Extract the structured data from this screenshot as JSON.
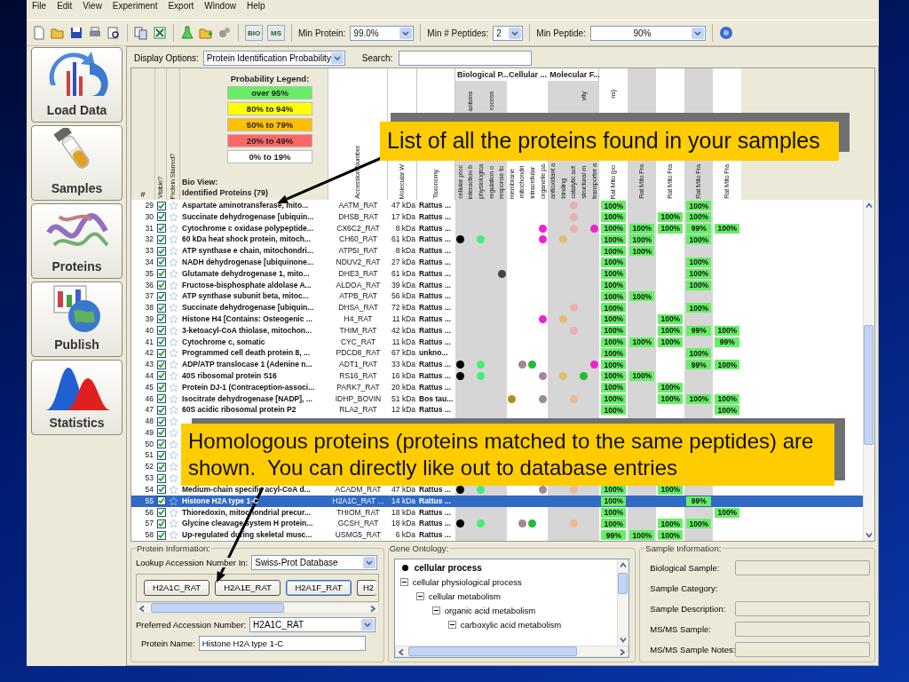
{
  "menu": [
    "File",
    "Edit",
    "View",
    "Experiment",
    "Export",
    "Window",
    "Help"
  ],
  "toolbar": {
    "badges": [
      "BIO",
      "MS"
    ],
    "filters": [
      {
        "label": "Min Protein:",
        "value": "99.0%",
        "kind": "short"
      },
      {
        "label": "Min # Peptides:",
        "value": "2",
        "kind": "tiny"
      },
      {
        "label": "Min Peptide:",
        "value": "90%",
        "kind": "wide"
      }
    ]
  },
  "sidebar": [
    {
      "label": "Load Data",
      "kind": "load"
    },
    {
      "label": "Samples",
      "kind": "samples"
    },
    {
      "label": "Proteins",
      "kind": "proteins"
    },
    {
      "label": "Publish",
      "kind": "publish"
    },
    {
      "label": "Statistics",
      "kind": "statistics"
    }
  ],
  "options": {
    "display_label": "Display Options:",
    "display_value": "Protein Identification Probability",
    "search_label": "Search:"
  },
  "legend": {
    "title": "Probability Legend:",
    "items": [
      {
        "label": "over 95%",
        "color": "#66ee66"
      },
      {
        "label": "80% to 94%",
        "color": "#ffff00"
      },
      {
        "label": "50% to 79%",
        "color": "#ffc000"
      },
      {
        "label": "20% to  49%",
        "color": "#ff6666"
      },
      {
        "label": "0% to 19%",
        "color": "#ffffff"
      }
    ]
  },
  "table": {
    "columns": {
      "number": "#",
      "visible": "Visible?",
      "starred": "Protein Starred?",
      "view": "Bio View:",
      "name": "Identified Proteins (79)",
      "accession": "Accession Number",
      "weight": "Molecular W",
      "taxonomy": "Taxonomy"
    },
    "go_groups": [
      {
        "label": "Biological P...",
        "columns": [
          {
            "label": "cellular proc"
          },
          {
            "label": "interaction b",
            "tail": "anisms"
          },
          {
            "label": "physiologica"
          },
          {
            "label": "regulation o",
            "tail": "rocess"
          },
          {
            "label": "response to"
          }
        ]
      },
      {
        "label": "Cellular ...",
        "columns": [
          {
            "label": "membrane"
          },
          {
            "label": "mitochondri"
          },
          {
            "label": "intracellular"
          },
          {
            "label": "organelle pa"
          }
        ]
      },
      {
        "label": "Molecular F...",
        "columns": [
          {
            "label": "antioxidant a"
          },
          {
            "label": "binding"
          },
          {
            "label": "catalytic act"
          },
          {
            "label": "structural m",
            "tail": "vity"
          },
          {
            "label": "transporter a"
          }
        ]
      }
    ],
    "sample_columns": [
      {
        "label": "Rat Mito (po",
        "tail": "ns)"
      },
      {
        "label": "Rat Mito Fra"
      },
      {
        "label": "Rat Mito Fra"
      },
      {
        "label": "Rat Mito Fra"
      },
      {
        "label": "Rat Mito Fra"
      }
    ],
    "rows": [
      {
        "num": "29",
        "visible": true,
        "starred": false,
        "selected": false,
        "name": "Aspartate aminotransferase, mito...",
        "accession": "AATM_RAT",
        "weight": "47 kDa",
        "taxonomy": "Rattus ...",
        "go": {
          "go_12": {
            "color": "#e8b0b0"
          }
        },
        "samples": {
          "sample_1": "100%",
          "sample_4": "100%"
        }
      },
      {
        "num": "30",
        "visible": true,
        "starred": false,
        "selected": false,
        "name": "Succinate dehydrogenase [ubiquin...",
        "accession": "DHSB_RAT",
        "weight": "17 kDa",
        "taxonomy": "Rattus ...",
        "go": {
          "go_12": {
            "color": "#e8b0b0"
          }
        },
        "samples": {
          "sample_1": "100%",
          "sample_3": "100%",
          "sample_4": "100%"
        }
      },
      {
        "num": "31",
        "visible": true,
        "starred": false,
        "selected": false,
        "name": "Cytochrome c oxidase polypeptide...",
        "accession": "CX6C2_RAT",
        "weight": "8 kDa",
        "taxonomy": "Rattus ...",
        "go": {
          "go_9": {
            "color": "#ee22cc"
          },
          "go_12": {
            "color": "#e8b0b0"
          },
          "go_14": {
            "color": "#ee22cc"
          }
        },
        "samples": {
          "sample_1": "100%",
          "sample_2": "100%",
          "sample_3": "100%",
          "sample_4": "99%",
          "sample_5": "100%"
        }
      },
      {
        "num": "32",
        "visible": true,
        "starred": false,
        "selected": false,
        "name": "60 kDa heat shock protein, mitoch...",
        "accession": "CH60_RAT",
        "weight": "61 kDa",
        "taxonomy": "Rattus ...",
        "go": {
          "go_1": {
            "color": "#000000"
          },
          "go_3": {
            "color": "#44ee77"
          },
          "go_9": {
            "color": "#ee22cc"
          },
          "go_11": {
            "color": "#e0c070"
          }
        },
        "samples": {
          "sample_1": "100%",
          "sample_2": "100%",
          "sample_4": "100%"
        }
      },
      {
        "num": "33",
        "visible": true,
        "starred": false,
        "selected": false,
        "name": "ATP synthase e chain, mitochondri...",
        "accession": "ATP5I_RAT",
        "weight": "8 kDa",
        "taxonomy": "Rattus ...",
        "samples": {
          "sample_1": "100%",
          "sample_2": "100%"
        }
      },
      {
        "num": "34",
        "visible": true,
        "starred": false,
        "selected": false,
        "name": "NADH dehydrogenase [ubiquinone...",
        "accession": "NDUV2_RAT",
        "weight": "27 kDa",
        "taxonomy": "Rattus ...",
        "samples": {
          "sample_1": "100%",
          "sample_4": "100%"
        }
      },
      {
        "num": "35",
        "visible": true,
        "starred": false,
        "selected": false,
        "name": "Glutamate dehydrogenase 1, mito...",
        "accession": "DHE3_RAT",
        "weight": "61 kDa",
        "taxonomy": "Rattus ...",
        "go": {
          "go_5": {
            "color": "#444444"
          }
        },
        "samples": {
          "sample_1": "100%",
          "sample_4": "100%"
        }
      },
      {
        "num": "36",
        "visible": true,
        "starred": false,
        "selected": false,
        "name": "Fructose-bisphosphate aldolase A...",
        "accession": "ALDOA_RAT",
        "weight": "39 kDa",
        "taxonomy": "Rattus ...",
        "samples": {
          "sample_1": "100%",
          "sample_4": "100%"
        }
      },
      {
        "num": "37",
        "visible": true,
        "starred": false,
        "selected": false,
        "name": "ATP synthase subunit beta, mitoc...",
        "accession": "ATPB_RAT",
        "weight": "56 kDa",
        "taxonomy": "Rattus ...",
        "samples": {
          "sample_1": "100%",
          "sample_2": "100%"
        }
      },
      {
        "num": "38",
        "visible": true,
        "starred": false,
        "selected": false,
        "name": "Succinate dehydrogenase [ubiquin...",
        "accession": "DHSA_RAT",
        "weight": "72 kDa",
        "taxonomy": "Rattus ...",
        "go": {
          "go_12": {
            "color": "#e8b0b0"
          }
        },
        "samples": {
          "sample_1": "100%",
          "sample_4": "100%"
        }
      },
      {
        "num": "39",
        "visible": true,
        "starred": false,
        "selected": false,
        "name": "Histone H4 [Contains: Osteogenic ...",
        "accession": "H4_RAT",
        "weight": "11 kDa",
        "taxonomy": "Rattus ...",
        "go": {
          "go_9": {
            "color": "#ee22cc"
          },
          "go_11": {
            "color": "#e0c070"
          }
        },
        "samples": {
          "sample_1": "100%",
          "sample_3": "100%"
        }
      },
      {
        "num": "40",
        "visible": true,
        "starred": false,
        "selected": false,
        "name": "3-ketoacyl-CoA thiolase, mitochon...",
        "accession": "THIM_RAT",
        "weight": "42 kDa",
        "taxonomy": "Rattus ...",
        "go": {
          "go_12": {
            "color": "#e8b0b0"
          }
        },
        "samples": {
          "sample_1": "100%",
          "sample_3": "100%",
          "sample_4": "99%",
          "sample_5": "100%"
        }
      },
      {
        "num": "41",
        "visible": true,
        "starred": false,
        "selected": false,
        "name": "Cytochrome c, somatic",
        "accession": "CYC_RAT",
        "weight": "11 kDa",
        "taxonomy": "Rattus ...",
        "samples": {
          "sample_1": "100%",
          "sample_2": "100%",
          "sample_3": "100%",
          "sample_5": "99%"
        }
      },
      {
        "num": "42",
        "visible": true,
        "starred": false,
        "selected": false,
        "name": "Programmed cell death protein 8, ...",
        "accession": "PDCD8_RAT",
        "weight": "67 kDa",
        "taxonomy": "unkno...",
        "samples": {
          "sample_1": "100%",
          "sample_4": "100%"
        }
      },
      {
        "num": "43",
        "visible": true,
        "starred": false,
        "selected": false,
        "name": "ADP/ATP translocase 1 (Adenine n...",
        "accession": "ADT1_RAT",
        "weight": "33 kDa",
        "taxonomy": "Rattus ...",
        "go": {
          "go_1": {
            "color": "#000000"
          },
          "go_3": {
            "color": "#44ee77"
          },
          "go_7": {
            "color": "#a08898"
          },
          "go_8": {
            "color": "#22bb33"
          },
          "go_14": {
            "color": "#ee22cc"
          }
        },
        "samples": {
          "sample_1": "100%",
          "sample_4": "99%",
          "sample_5": "100%"
        }
      },
      {
        "num": "44",
        "visible": true,
        "starred": false,
        "selected": false,
        "name": "40S ribosomal protein S16",
        "accession": "RS16_RAT",
        "weight": "16 kDa",
        "taxonomy": "Rattus ...",
        "go": {
          "go_1": {
            "color": "#000000"
          },
          "go_3": {
            "color": "#44ee77"
          },
          "go_9": {
            "color": "#a08898"
          },
          "go_11": {
            "color": "#e0c070"
          },
          "go_13": {
            "color": "#22bb33"
          }
        },
        "samples": {
          "sample_1": "100%",
          "sample_2": "100%"
        }
      },
      {
        "num": "45",
        "visible": true,
        "starred": false,
        "selected": false,
        "name": "Protein DJ-1 (Contraception-associ...",
        "accession": "PARK7_RAT",
        "weight": "20 kDa",
        "taxonomy": "Rattus ...",
        "samples": {
          "sample_1": "100%",
          "sample_3": "100%"
        }
      },
      {
        "num": "46",
        "visible": true,
        "starred": false,
        "selected": false,
        "name": "Isocitrate dehydrogenase [NADP], ...",
        "accession": "IDHP_BOVIN",
        "weight": "51 kDa",
        "taxonomy": "Bos tau...",
        "go": {
          "go_6": {
            "color": "#b88a20"
          },
          "go_9": {
            "color": "#a08898"
          },
          "go_12": {
            "color": "#f0b890"
          }
        },
        "samples": {
          "sample_1": "100%",
          "sample_3": "100%",
          "sample_4": "100%",
          "sample_5": "100%"
        }
      },
      {
        "num": "47",
        "visible": true,
        "starred": false,
        "selected": false,
        "name": "60S acidic ribosomal protein P2",
        "accession": "RLA2_RAT",
        "weight": "12 kDa",
        "taxonomy": "Rattus ...",
        "samples": {
          "sample_1": "100%",
          "sample_5": "100%"
        }
      },
      {
        "num": "48",
        "visible": true,
        "starred": false,
        "selected": false
      },
      {
        "num": "49",
        "visible": true,
        "starred": false,
        "selected": false
      },
      {
        "num": "50",
        "visible": true,
        "starred": false,
        "selected": false
      },
      {
        "num": "51",
        "visible": true,
        "starred": false,
        "selected": false
      },
      {
        "num": "52",
        "visible": true,
        "starred": false,
        "selected": false
      },
      {
        "num": "53",
        "visible": true,
        "starred": false,
        "selected": false
      },
      {
        "num": "54",
        "visible": true,
        "starred": false,
        "selected": false,
        "name": "Medium-chain specific acyl-CoA d...",
        "accession": "ACADM_RAT",
        "weight": "47 kDa",
        "taxonomy": "Rattus ...",
        "go": {
          "go_1": {
            "color": "#000000"
          },
          "go_3": {
            "color": "#44ee77"
          },
          "go_9": {
            "color": "#a08898"
          },
          "go_12": {
            "color": "#f0b890"
          }
        },
        "samples": {
          "sample_1": "100%",
          "sample_3": "100%"
        }
      },
      {
        "num": "55",
        "visible": true,
        "starred": false,
        "selected": true,
        "name": "Histone H2A type 1-C",
        "accession": "H2A1C_RAT ...",
        "weight": "14 kDa",
        "taxonomy": "Rattus ...",
        "samples": {
          "sample_1": "100%",
          "sample_4": "99%"
        }
      },
      {
        "num": "56",
        "visible": true,
        "starred": false,
        "selected": false,
        "name": "Thioredoxin, mitochondrial precur...",
        "accession": "THIOM_RAT",
        "weight": "18 kDa",
        "taxonomy": "Rattus ...",
        "samples": {
          "sample_1": "100%",
          "sample_5": "100%"
        }
      },
      {
        "num": "57",
        "visible": true,
        "starred": false,
        "selected": false,
        "name": "Glycine cleavage system H protein...",
        "accession": "GCSH_RAT",
        "weight": "18 kDa",
        "taxonomy": "Rattus ...",
        "go": {
          "go_1": {
            "color": "#000000"
          },
          "go_3": {
            "color": "#44ee77"
          },
          "go_7": {
            "color": "#a08898"
          },
          "go_8": {
            "color": "#22bb33"
          },
          "go_12": {
            "color": "#f0b890"
          }
        },
        "samples": {
          "sample_1": "100%",
          "sample_3": "100%",
          "sample_4": "100%"
        }
      },
      {
        "num": "58",
        "visible": true,
        "starred": false,
        "selected": false,
        "name": "Up-regulated during skeletal musc...",
        "accession": "USMG5_RAT",
        "weight": "6 kDa",
        "taxonomy": "Rattus ...",
        "samples": {
          "sample_1": "99%",
          "sample_2": "100%",
          "sample_3": "100%"
        }
      }
    ]
  },
  "protein_info": {
    "title": "Protein Information:",
    "lookup_label": "Lookup Accession Number In:",
    "lookup_value": "Swiss-Prot Database",
    "accessions": [
      {
        "label": "H2A1C_RAT",
        "focused": false
      },
      {
        "label": "H2A1E_RAT",
        "focused": false
      },
      {
        "label": "H2A1F_RAT",
        "focused": true
      },
      {
        "label": "H2",
        "focused": false
      }
    ],
    "preferred_label": "Preferred Accession Number:",
    "preferred_value": "H2A1C_RAT",
    "name_label": "Protein Name:",
    "name_value": "Histone H2A type 1-C"
  },
  "gene_ontology": {
    "title": "Gene Ontology:",
    "items": [
      {
        "label": "cellular process",
        "kind": "heading"
      },
      {
        "label": "cellular physiological process",
        "kind": "node",
        "expanded": true,
        "children": [
          {
            "label": "cellular metabolism",
            "kind": "node",
            "expanded": true,
            "children": [
              {
                "label": "organic acid metabolism",
                "kind": "node",
                "expanded": true,
                "children": [
                  {
                    "label": "carboxylic acid metabolism",
                    "kind": "node",
                    "expanded": true
                  }
                ]
              }
            ]
          }
        ]
      }
    ]
  },
  "sample_info": {
    "title": "Sample Information:",
    "fields": [
      {
        "label": "Biological Sample:",
        "kind": "field"
      },
      {
        "label": "Sample Category:",
        "kind": "text"
      },
      {
        "label": "Sample Description:",
        "kind": "field"
      },
      {
        "label": "MS/MS Sample:",
        "kind": "field"
      },
      {
        "label": "MS/MS Sample Notes:",
        "kind": "field"
      }
    ]
  },
  "callouts": [
    {
      "text": "List of all the proteins found in your samples",
      "kind": "top"
    },
    {
      "text": "Homologous proteins (proteins matched to the same peptides) are shown.  You can directly like out to database entries",
      "kind": "bottom"
    }
  ]
}
